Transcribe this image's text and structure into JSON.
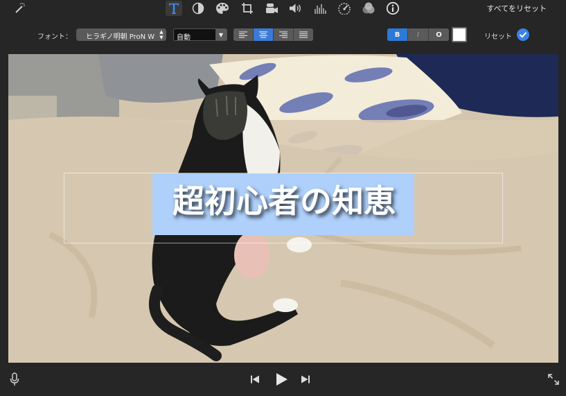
{
  "toolbar": {
    "tools": [
      {
        "name": "enhance",
        "icon": "magic-wand-icon"
      },
      {
        "name": "title",
        "icon": "text-T-icon",
        "active": true
      },
      {
        "name": "color-balance",
        "icon": "color-balance-icon"
      },
      {
        "name": "color-correction",
        "icon": "palette-icon"
      },
      {
        "name": "crop",
        "icon": "crop-icon"
      },
      {
        "name": "stabilization",
        "icon": "video-camera-icon"
      },
      {
        "name": "volume",
        "icon": "speaker-icon"
      },
      {
        "name": "noise-reduction",
        "icon": "equalizer-icon"
      },
      {
        "name": "speed",
        "icon": "speedometer-icon"
      },
      {
        "name": "clip-filter",
        "icon": "overlapping-circles-icon"
      },
      {
        "name": "info",
        "icon": "info-icon"
      }
    ],
    "reset_all_label": "すべてをリセット"
  },
  "format": {
    "font_label": "フォント：",
    "font_value": "ヒラギノ明朝 ProN W",
    "size_value": "自動",
    "alignment_options": [
      "left",
      "center",
      "right",
      "justify"
    ],
    "alignment_selected": "center",
    "style_buttons": {
      "bold": "B",
      "italic": "I",
      "outline": "O"
    },
    "bold_active": true,
    "text_color": "#ffffff",
    "reset_label": "リセット"
  },
  "viewer": {
    "title_text": "超初心者の知恵",
    "selection_color": "#aed0fb"
  },
  "accent_color": "#3b7ad7"
}
